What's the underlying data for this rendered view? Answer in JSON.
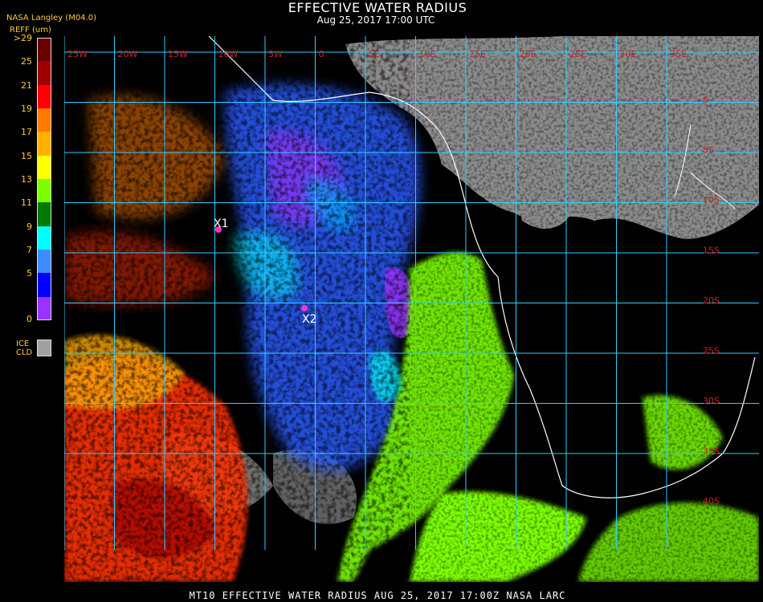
{
  "header": {
    "title": "EFFECTIVE WATER RADIUS",
    "subtitle": "Aug 25, 2017 17:00 UTC",
    "agency": "NASA Langley (M04.0)",
    "units": "REFF (um)"
  },
  "colorbar": {
    "bins": [
      {
        "label": ">29",
        "color": "#6a0000"
      },
      {
        "label": "25",
        "color": "#a00000"
      },
      {
        "label": "21",
        "color": "#ff0000"
      },
      {
        "label": "19",
        "color": "#ff7a00"
      },
      {
        "label": "17",
        "color": "#ffb000"
      },
      {
        "label": "15",
        "color": "#ffff00"
      },
      {
        "label": "13",
        "color": "#7dff00"
      },
      {
        "label": "11",
        "color": "#007a00"
      },
      {
        "label": "9",
        "color": "#00ffff"
      },
      {
        "label": "7",
        "color": "#3a8cff"
      },
      {
        "label": "5",
        "color": "#0000ff"
      },
      {
        "label": "0",
        "color": "#9933ff"
      }
    ],
    "ice_label_1": "ICE",
    "ice_label_2": "CLD",
    "ice_color": "#a0a0a0"
  },
  "map": {
    "lon_labels": [
      "25W",
      "20W",
      "15W",
      "10W",
      "5W",
      "0",
      "5E",
      "10E",
      "15E",
      "20E",
      "25E",
      "30E",
      "35E"
    ],
    "lat_labels": [
      "0",
      "5S",
      "10S",
      "15S",
      "20S",
      "25S",
      "30S",
      "35S",
      "40S"
    ],
    "grid_color": "#33ccff",
    "label_color": "#cc2222",
    "markers": [
      {
        "label": "X1",
        "color": "#ff33cc"
      },
      {
        "label": "X2",
        "color": "#ff33cc"
      }
    ]
  },
  "footer": {
    "text": "MT10  EFFECTIVE WATER RADIUS  AUG 25, 2017 17:00Z  NASA LARC"
  }
}
